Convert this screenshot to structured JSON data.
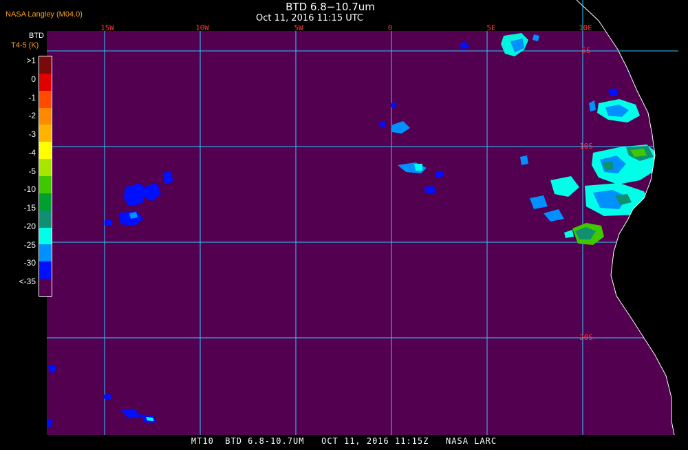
{
  "header": {
    "credit": "NASA Langley (M04.0)",
    "title": "BTD 6.8−10.7um",
    "subtitle": "Oct 11, 2016 11:15 UTC"
  },
  "footer": {
    "text": "MT10  BTD 6.8-10.7UM   OCT 11, 2016 11:15Z   NASA LARC"
  },
  "legend": {
    "title": "BTD",
    "subtitle": "T4-5 (K)",
    "labels": [
      ">1",
      "0",
      "-1",
      "-2",
      "-3",
      "-4",
      "-5",
      "-10",
      "-15",
      "-20",
      "-25",
      "-30",
      "<-35"
    ],
    "colors": [
      "#7a0a0a",
      "#e00000",
      "#ff4a00",
      "#ff8a00",
      "#ffb400",
      "#ffff00",
      "#a8e600",
      "#3fc800",
      "#00a030",
      "#109070",
      "#00ffe8",
      "#0090ff",
      "#0010ff",
      "#540050"
    ]
  },
  "map": {
    "background_color": "#540050",
    "grid_color": "#30c8ff",
    "coast_color": "#ffffff",
    "lon_labels": [
      "15W",
      "10W",
      "5W",
      "0",
      "5E",
      "10E"
    ],
    "lat_labels": [
      "5S",
      "10S",
      "20S"
    ]
  }
}
